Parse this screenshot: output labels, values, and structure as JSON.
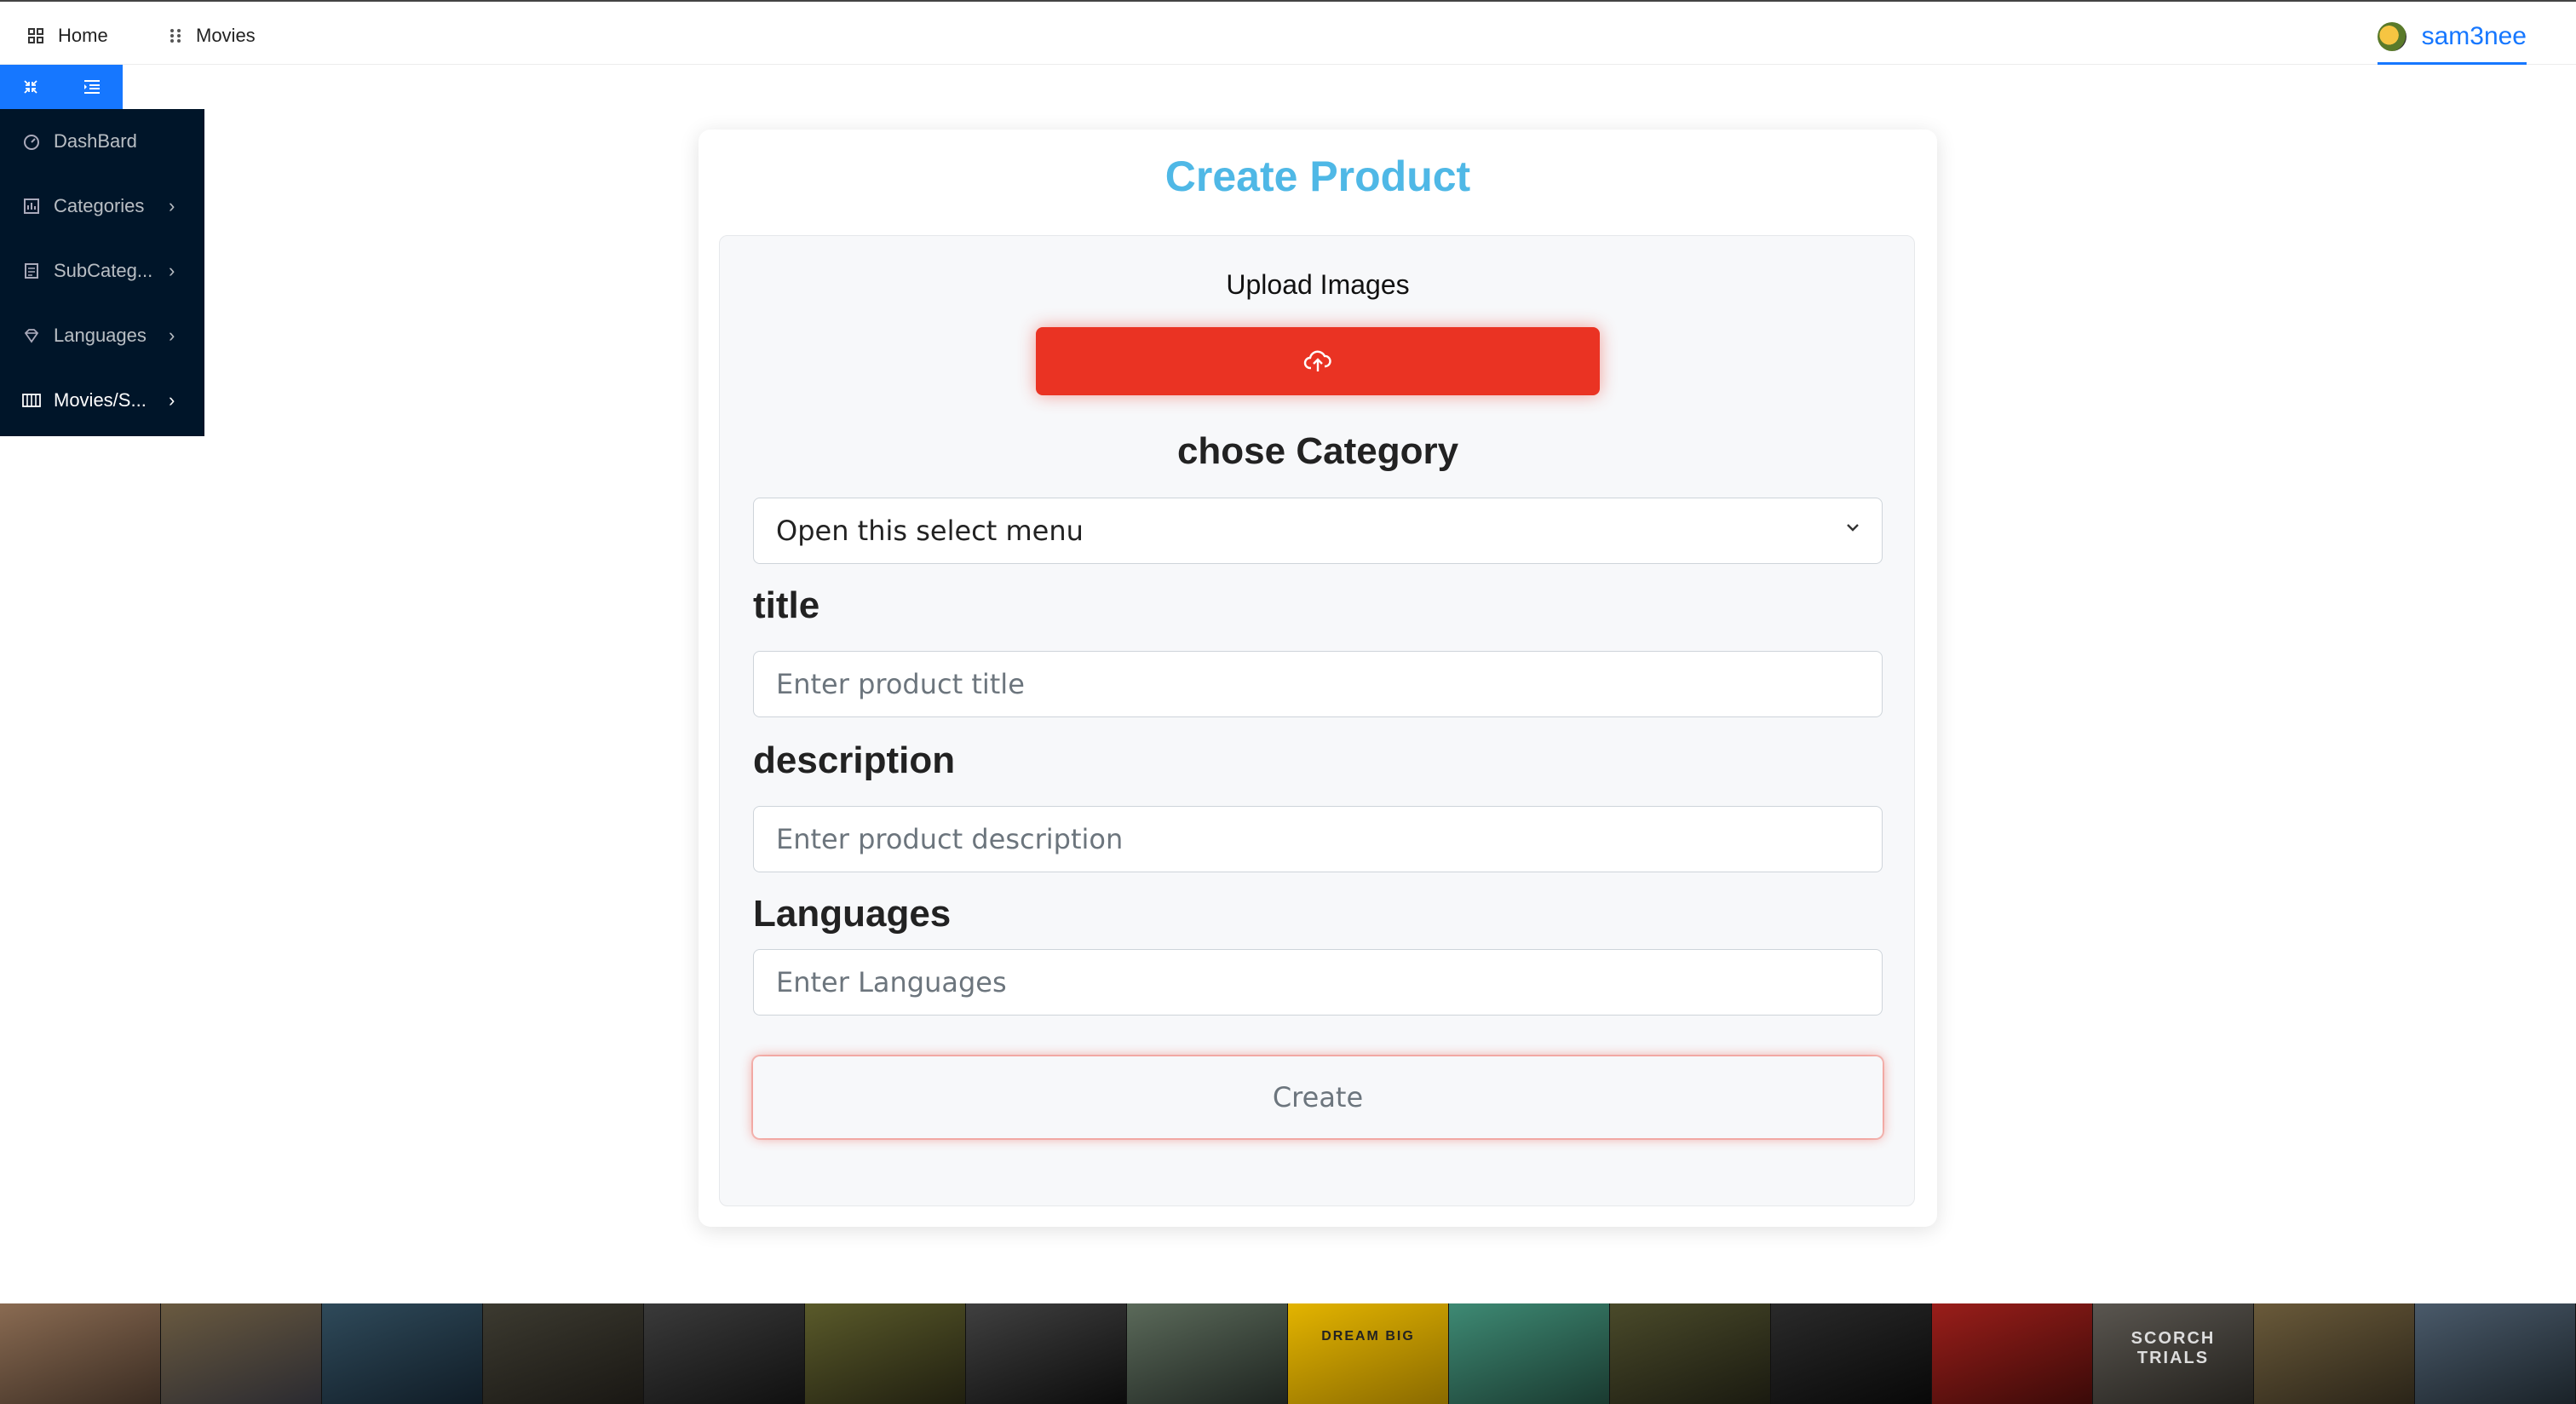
{
  "topnav": {
    "home_label": "Home",
    "movies_label": "Movies",
    "username": "sam3nee"
  },
  "sidebar": {
    "items": [
      {
        "label": "DashBard",
        "icon": "dashboard-icon",
        "has_chevron": false
      },
      {
        "label": "Categories",
        "icon": "categories-icon",
        "has_chevron": true
      },
      {
        "label": "SubCateg...",
        "icon": "subcategories-icon",
        "has_chevron": true
      },
      {
        "label": "Languages",
        "icon": "languages-icon",
        "has_chevron": true
      },
      {
        "label": "Movies/S...",
        "icon": "movies-icon",
        "has_chevron": true,
        "active": true
      }
    ]
  },
  "form": {
    "title": "Create Product",
    "upload_label": "Upload Images",
    "category_label": "chose Category",
    "category_select_value": "Open this select menu",
    "title_label": "title",
    "title_placeholder": "Enter product title",
    "description_label": "description",
    "description_placeholder": "Enter product description",
    "languages_label": "Languages",
    "languages_placeholder": "Enter Languages",
    "submit_label": "Create"
  },
  "strip": {
    "poster_texts": [
      "",
      "",
      "",
      "",
      "",
      "",
      "",
      "",
      "DREAM BIG",
      "",
      "",
      "",
      "",
      "SCORCH TRIALS",
      "",
      ""
    ]
  },
  "colors": {
    "accent": "#1677ff",
    "sidebar_bg": "#001529",
    "title": "#4fb8e6",
    "upload": "#ea3323"
  }
}
